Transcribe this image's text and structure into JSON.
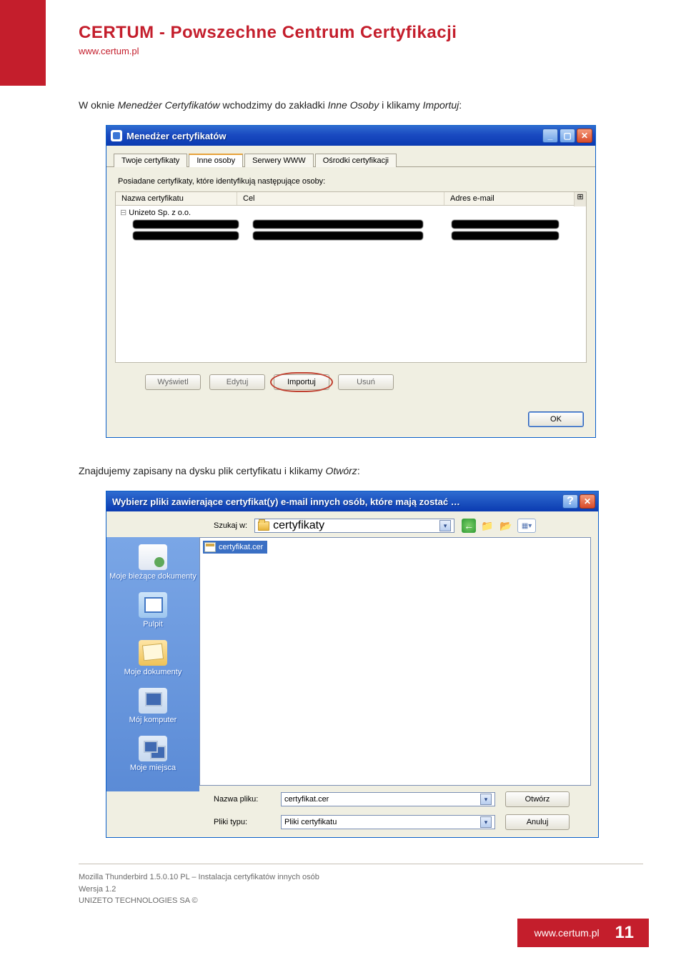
{
  "header": {
    "title": "CERTUM - Powszechne Centrum Certyfikacji",
    "site": "www.certum.pl"
  },
  "intro": {
    "p1a": "W oknie ",
    "p1b": "Menedżer Certyfikatów",
    "p1c": " wchodzimy do zakładki ",
    "p1d": "Inne Osoby",
    "p1e": " i klikamy ",
    "p1f": "Importuj",
    "p1g": ":"
  },
  "cm": {
    "title": "Menedżer certyfikatów",
    "tabs": [
      "Twoje certyfikaty",
      "Inne osoby",
      "Serwery WWW",
      "Ośrodki certyfikacji"
    ],
    "caption": "Posiadane certyfikaty, które identyfikują następujące osoby:",
    "columns": {
      "name": "Nazwa certyfikatu",
      "purpose": "Cel",
      "email": "Adres e-mail"
    },
    "org": "Unizeto Sp. z o.o.",
    "buttons": {
      "view": "Wyświetl",
      "edit": "Edytuj",
      "import": "Importuj",
      "delete": "Usuń",
      "ok": "OK"
    },
    "minimize": "_",
    "maximize": "▢",
    "close": "✕"
  },
  "para2": {
    "a": "Znajdujemy zapisany na dysku plik certyfikatu i klikamy ",
    "b": "Otwórz",
    "c": ":"
  },
  "fd": {
    "title": "Wybierz pliki zawierające certyfikat(y) e-mail innych osób, które mają zostać …",
    "lookin_label": "Szukaj w:",
    "lookin_value": "certyfikaty",
    "file_item": "certyfikat.cer",
    "places": {
      "recent": "Moje bieżące dokumenty",
      "desktop": "Pulpit",
      "mydocs": "Moje dokumenty",
      "mypc": "Mój komputer",
      "net": "Moje miejsca"
    },
    "filename_label": "Nazwa pliku:",
    "filename_value": "certyfikat.cer",
    "filetype_label": "Pliki typu:",
    "filetype_value": "Pliki certyfikatu",
    "open": "Otwórz",
    "cancel": "Anuluj",
    "help": "?",
    "close": "✕"
  },
  "footer": {
    "line1": "Mozilla Thunderbird 1.5.0.10 PL  –  Instalacja certyfikatów innych osób",
    "line2": "Wersja 1.2",
    "line3": "UNIZETO TECHNOLOGIES SA ©",
    "site": "www.certum.pl",
    "page": "11"
  }
}
